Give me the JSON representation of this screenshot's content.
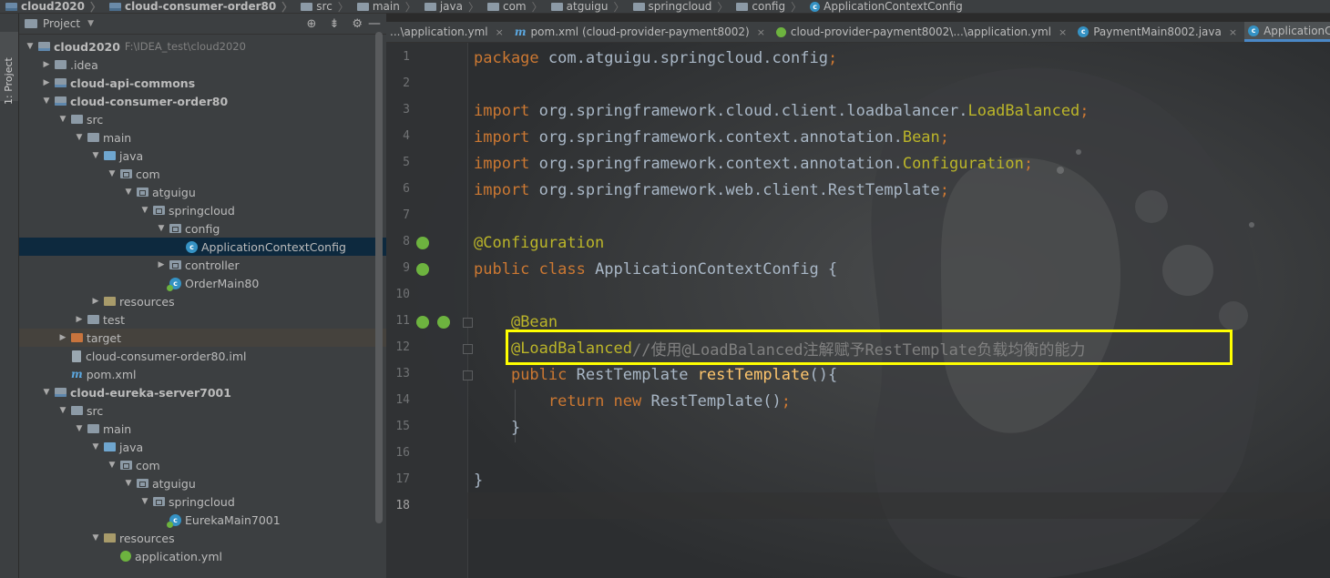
{
  "breadcrumb": [
    "cloud2020",
    "cloud-consumer-order80",
    "src",
    "main",
    "java",
    "com",
    "atguigu",
    "springcloud",
    "config",
    "ApplicationContextConfig"
  ],
  "sidebar": {
    "tab_label": "1: Project"
  },
  "project_panel": {
    "title": "Project",
    "tree": [
      {
        "label": "cloud2020",
        "path": "F:\\IDEA_test\\cloud2020",
        "icon": "module-folder-icon",
        "depth": 0,
        "expanded": true,
        "bold": true
      },
      {
        "label": ".idea",
        "icon": "folder-icon",
        "depth": 1,
        "expanded": false
      },
      {
        "label": "cloud-api-commons",
        "icon": "module-folder-icon",
        "depth": 1,
        "expanded": false,
        "bold": true
      },
      {
        "label": "cloud-consumer-order80",
        "icon": "module-folder-icon",
        "depth": 1,
        "expanded": true,
        "bold": true
      },
      {
        "label": "src",
        "icon": "folder-icon",
        "depth": 2,
        "expanded": true
      },
      {
        "label": "main",
        "icon": "folder-icon",
        "depth": 3,
        "expanded": true
      },
      {
        "label": "java",
        "icon": "source-folder-icon",
        "depth": 4,
        "expanded": true
      },
      {
        "label": "com",
        "icon": "package-icon",
        "depth": 5,
        "expanded": true
      },
      {
        "label": "atguigu",
        "icon": "package-icon",
        "depth": 6,
        "expanded": true
      },
      {
        "label": "springcloud",
        "icon": "package-icon",
        "depth": 7,
        "expanded": true
      },
      {
        "label": "config",
        "icon": "package-icon",
        "depth": 8,
        "expanded": true
      },
      {
        "label": "ApplicationContextConfig",
        "icon": "class-icon",
        "depth": 9,
        "selected": true
      },
      {
        "label": "controller",
        "icon": "package-icon",
        "depth": 8,
        "expanded": false
      },
      {
        "label": "OrderMain80",
        "icon": "spring-class-icon",
        "depth": 8
      },
      {
        "label": "resources",
        "icon": "resources-folder-icon",
        "depth": 4,
        "expanded": false
      },
      {
        "label": "test",
        "icon": "folder-icon",
        "depth": 3,
        "expanded": false
      },
      {
        "label": "target",
        "icon": "target-folder-icon",
        "depth": 2,
        "expanded": false,
        "excluded": true
      },
      {
        "label": "cloud-consumer-order80.iml",
        "icon": "iml-file-icon",
        "depth": 2
      },
      {
        "label": "pom.xml",
        "icon": "maven-file-icon",
        "depth": 2
      },
      {
        "label": "cloud-eureka-server7001",
        "icon": "module-folder-icon",
        "depth": 1,
        "expanded": true,
        "bold": true
      },
      {
        "label": "src",
        "icon": "folder-icon",
        "depth": 2,
        "expanded": true
      },
      {
        "label": "main",
        "icon": "folder-icon",
        "depth": 3,
        "expanded": true
      },
      {
        "label": "java",
        "icon": "source-folder-icon",
        "depth": 4,
        "expanded": true
      },
      {
        "label": "com",
        "icon": "package-icon",
        "depth": 5,
        "expanded": true
      },
      {
        "label": "atguigu",
        "icon": "package-icon",
        "depth": 6,
        "expanded": true
      },
      {
        "label": "springcloud",
        "icon": "package-icon",
        "depth": 7,
        "expanded": true
      },
      {
        "label": "EurekaMain7001",
        "icon": "spring-class-icon",
        "depth": 8
      },
      {
        "label": "resources",
        "icon": "resources-folder-icon",
        "depth": 4,
        "expanded": true
      },
      {
        "label": "application.yml",
        "icon": "yml-file-icon",
        "depth": 5
      }
    ]
  },
  "editor_tabs": [
    {
      "label": "...\\application.yml",
      "icon": "none"
    },
    {
      "label": "pom.xml (cloud-provider-payment8002)",
      "icon": "maven-file-icon"
    },
    {
      "label": "cloud-provider-payment8002\\...\\application.yml",
      "icon": "yml-file-icon"
    },
    {
      "label": "PaymentMain8002.java",
      "icon": "class-icon"
    },
    {
      "label": "ApplicationCon",
      "icon": "class-icon",
      "active": true
    }
  ],
  "editor": {
    "current_line": 18,
    "highlighted_line": 12,
    "lines": [
      [
        {
          "t": "package ",
          "c": "kw"
        },
        {
          "t": "com.atguigu.springcloud.config",
          "c": ""
        },
        {
          "t": ";",
          "c": "kw"
        }
      ],
      [],
      [
        {
          "t": "import ",
          "c": "kw"
        },
        {
          "t": "org.springframework.cloud.client.loadbalancer.",
          "c": ""
        },
        {
          "t": "LoadBalanced",
          "c": "ann"
        },
        {
          "t": ";",
          "c": "kw"
        }
      ],
      [
        {
          "t": "import ",
          "c": "kw"
        },
        {
          "t": "org.springframework.context.annotation.",
          "c": ""
        },
        {
          "t": "Bean",
          "c": "ann"
        },
        {
          "t": ";",
          "c": "kw"
        }
      ],
      [
        {
          "t": "import ",
          "c": "kw"
        },
        {
          "t": "org.springframework.context.annotation.",
          "c": ""
        },
        {
          "t": "Configuration",
          "c": "ann"
        },
        {
          "t": ";",
          "c": "kw"
        }
      ],
      [
        {
          "t": "import ",
          "c": "kw"
        },
        {
          "t": "org.springframework.web.client.RestTemplate",
          "c": ""
        },
        {
          "t": ";",
          "c": "kw"
        }
      ],
      [],
      [
        {
          "t": "@Configuration",
          "c": "ann"
        }
      ],
      [
        {
          "t": "public class ",
          "c": "kw"
        },
        {
          "t": "ApplicationContextConfig {",
          "c": ""
        }
      ],
      [],
      [
        {
          "t": "    ",
          "c": ""
        },
        {
          "t": "@Bean",
          "c": "ann"
        }
      ],
      [
        {
          "t": "    ",
          "c": ""
        },
        {
          "t": "@LoadBalanced",
          "c": "ann"
        },
        {
          "t": "//使用@LoadBalanced注解赋予RestTemplate负载均衡的能力",
          "c": "cmt"
        }
      ],
      [
        {
          "t": "    ",
          "c": ""
        },
        {
          "t": "public ",
          "c": "kw"
        },
        {
          "t": "RestTemplate ",
          "c": ""
        },
        {
          "t": "restTemplate",
          "c": "fn"
        },
        {
          "t": "(){",
          "c": ""
        }
      ],
      [
        {
          "t": "        ",
          "c": ""
        },
        {
          "t": "return new ",
          "c": "kw"
        },
        {
          "t": "RestTemplate()",
          "c": ""
        },
        {
          "t": ";",
          "c": "kw"
        }
      ],
      [
        {
          "t": "    }",
          "c": ""
        }
      ],
      [],
      [
        {
          "t": "}",
          "c": ""
        }
      ],
      []
    ]
  },
  "colors": {
    "keyword": "#cc7832",
    "annotation": "#bbb529",
    "comment": "#808080",
    "method": "#ffc66d",
    "text": "#a9b7c6",
    "highlight_box": "#ffff00"
  }
}
